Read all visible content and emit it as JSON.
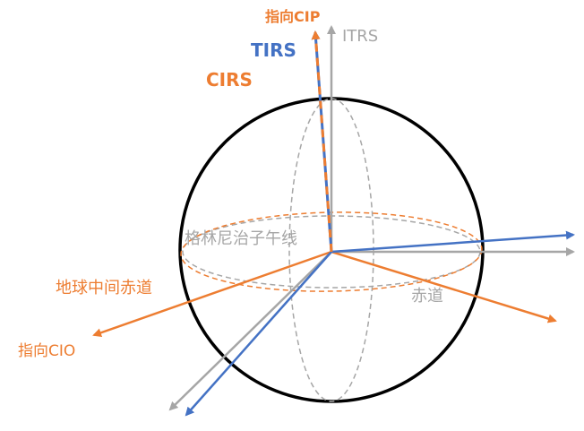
{
  "colors": {
    "orange": "#ED7D31",
    "blue": "#4472C4",
    "gray": "#A6A6A6",
    "black": "#000000"
  },
  "labels": {
    "cip": "指向CIP",
    "tirs": "TIRS",
    "itrs": "ITRS",
    "cirs": "CIRS",
    "greenwich": "格林尼治子午线",
    "equator": "赤道",
    "intermediate_equator": "地球中间赤道",
    "cio": "指向CIO"
  }
}
